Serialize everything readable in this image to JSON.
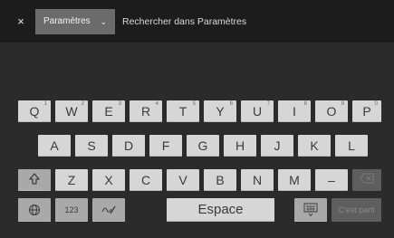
{
  "topbar": {
    "close_icon": "close-icon",
    "close_glyph": "×",
    "dropdown_label": "Paramètres",
    "dropdown_chevron": "⌄",
    "search_placeholder": "Rechercher dans Paramètres"
  },
  "keyboard": {
    "row1": [
      {
        "label": "Q",
        "num": "1"
      },
      {
        "label": "W",
        "num": "2"
      },
      {
        "label": "E",
        "num": "3"
      },
      {
        "label": "R",
        "num": "4"
      },
      {
        "label": "T",
        "num": "5"
      },
      {
        "label": "Y",
        "num": "6"
      },
      {
        "label": "U",
        "num": "7"
      },
      {
        "label": "I",
        "num": "8"
      },
      {
        "label": "O",
        "num": "9"
      },
      {
        "label": "P",
        "num": "0"
      }
    ],
    "row2": [
      "A",
      "S",
      "D",
      "F",
      "G",
      "H",
      "J",
      "K",
      "L"
    ],
    "row3": [
      "Z",
      "X",
      "C",
      "V",
      "B",
      "N",
      "M",
      "–"
    ],
    "shift_icon": "shift-arrow-icon",
    "backspace_icon": "backspace-icon",
    "globe_icon": "globe-icon",
    "numbers_label": "123",
    "handwriting_icon": "handwriting-icon",
    "space_label": "Espace",
    "hide_keyboard_icon": "keyboard-hide-icon",
    "go_label": "C'est parti"
  }
}
